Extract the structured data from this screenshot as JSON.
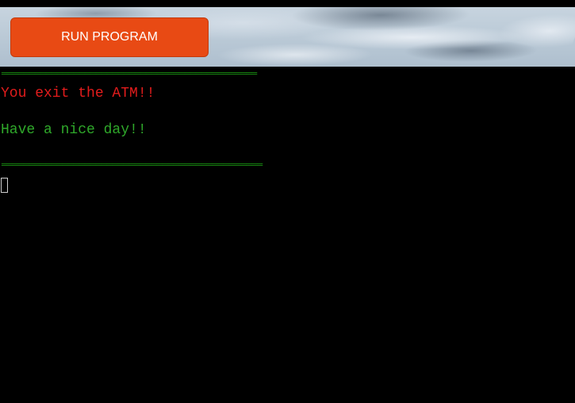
{
  "header": {
    "run_button_label": "RUN PROGRAM"
  },
  "terminal": {
    "separator_top": "==============================================",
    "exit_message": "You exit the ATM!!",
    "goodbye_message": "Have a nice day!!",
    "separator_bottom": "==============================================="
  },
  "colors": {
    "button_bg": "#e84a14",
    "terminal_bg": "#000000",
    "text_red": "#e31c1c",
    "text_green": "#2fa82a",
    "separator_green": "#22c81a"
  }
}
